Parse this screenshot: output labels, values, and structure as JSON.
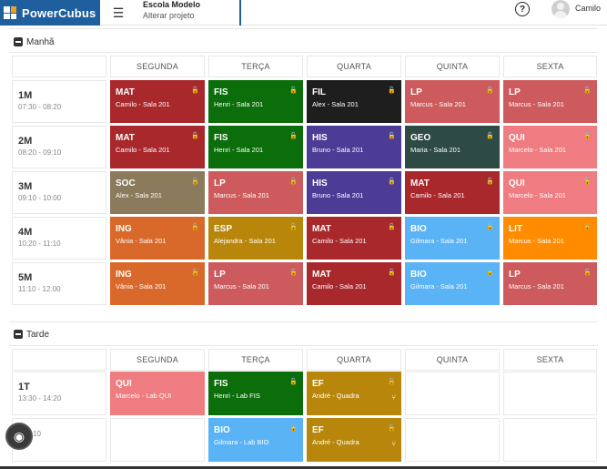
{
  "app": {
    "name": "PowerCubus"
  },
  "project": {
    "org": "Escola Modelo",
    "action": "Alterar projeto"
  },
  "user": {
    "name": "Camilo"
  },
  "icons": {
    "menu": "menu-icon",
    "help": "help-icon",
    "lock": "lock-icon",
    "share": "share-icon",
    "lens": "lens-icon"
  },
  "days": [
    "SEGUNDA",
    "TERÇA",
    "QUARTA",
    "QUINTA",
    "SEXTA"
  ],
  "morning": {
    "title": "Manhã",
    "rows": [
      {
        "code": "1M",
        "time": "07:30 - 08:20",
        "slots": [
          {
            "subj": "MAT",
            "who": "Camilo - Sala 201",
            "color": "#a8282c"
          },
          {
            "subj": "FIS",
            "who": "Henri - Sala 201",
            "color": "#0b6e0b"
          },
          {
            "subj": "FIL",
            "who": "Alex - Sala 201",
            "color": "#1e1e1e"
          },
          {
            "subj": "LP",
            "who": "Marcus - Sala 201",
            "color": "#cd5b5e"
          },
          {
            "subj": "LP",
            "who": "Marcus - Sala 201",
            "color": "#cd5b5e"
          }
        ]
      },
      {
        "code": "2M",
        "time": "08:20 - 09:10",
        "slots": [
          {
            "subj": "MAT",
            "who": "Camilo - Sala 201",
            "color": "#a8282c"
          },
          {
            "subj": "FIS",
            "who": "Henri - Sala 201",
            "color": "#0b6e0b"
          },
          {
            "subj": "HIS",
            "who": "Bruno - Sala 201",
            "color": "#4d3c96"
          },
          {
            "subj": "GEO",
            "who": "Maria - Sala 201",
            "color": "#2d4a45"
          },
          {
            "subj": "QUI",
            "who": "Marcelo - Sala 201",
            "color": "#ee7c80"
          }
        ]
      },
      {
        "code": "3M",
        "time": "09:10 - 10:00",
        "slots": [
          {
            "subj": "SOC",
            "who": "Alex - Sala 201",
            "color": "#8b7a5c"
          },
          {
            "subj": "LP",
            "who": "Marcus - Sala 201",
            "color": "#cd5b5e"
          },
          {
            "subj": "HIS",
            "who": "Bruno - Sala 201",
            "color": "#4d3c96"
          },
          {
            "subj": "MAT",
            "who": "Camilo - Sala 201",
            "color": "#a8282c"
          },
          {
            "subj": "QUI",
            "who": "Marcelo - Sala 201",
            "color": "#ee7c80"
          }
        ]
      },
      {
        "code": "4M",
        "time": "10:20 - 11:10",
        "slots": [
          {
            "subj": "ING",
            "who": "Vânia - Sala 201",
            "color": "#d9692a"
          },
          {
            "subj": "ESP",
            "who": "Alejandra - Sala 201",
            "color": "#b8860b"
          },
          {
            "subj": "MAT",
            "who": "Camilo - Sala 201",
            "color": "#a8282c"
          },
          {
            "subj": "BIO",
            "who": "Gilmara - Sala 201",
            "color": "#5ab3f5"
          },
          {
            "subj": "LIT",
            "who": "Marcus - Sala 201",
            "color": "#ff8c00"
          }
        ]
      },
      {
        "code": "5M",
        "time": "11:10 - 12:00",
        "slots": [
          {
            "subj": "ING",
            "who": "Vânia - Sala 201",
            "color": "#d9692a"
          },
          {
            "subj": "LP",
            "who": "Marcus - Sala 201",
            "color": "#cd5b5e"
          },
          {
            "subj": "MAT",
            "who": "Camilo - Sala 201",
            "color": "#a8282c"
          },
          {
            "subj": "BIO",
            "who": "Gilmara - Sala 201",
            "color": "#5ab3f5"
          },
          {
            "subj": "LP",
            "who": "Marcus - Sala 201",
            "color": "#cd5b5e"
          }
        ]
      }
    ]
  },
  "afternoon": {
    "title": "Tarde",
    "rows": [
      {
        "code": "1T",
        "time": "13:30 - 14:20",
        "slots": [
          {
            "subj": "QUI",
            "who": "Marcelo - Lab QUI",
            "color": "#ee7c80",
            "lock": false
          },
          {
            "subj": "FIS",
            "who": "Henri - Lab FIS",
            "color": "#0b6e0b"
          },
          {
            "subj": "EF",
            "who": "André - Quadra",
            "color": "#b8860b",
            "share": true
          },
          null,
          null
        ]
      },
      {
        "code": "",
        "time": "- 15:10",
        "slots": [
          null,
          {
            "subj": "BIO",
            "who": "Gilmara - Lab BIO",
            "color": "#5ab3f5"
          },
          {
            "subj": "EF",
            "who": "André - Quadra",
            "color": "#b8860b",
            "share": true
          },
          null,
          null
        ]
      }
    ]
  }
}
